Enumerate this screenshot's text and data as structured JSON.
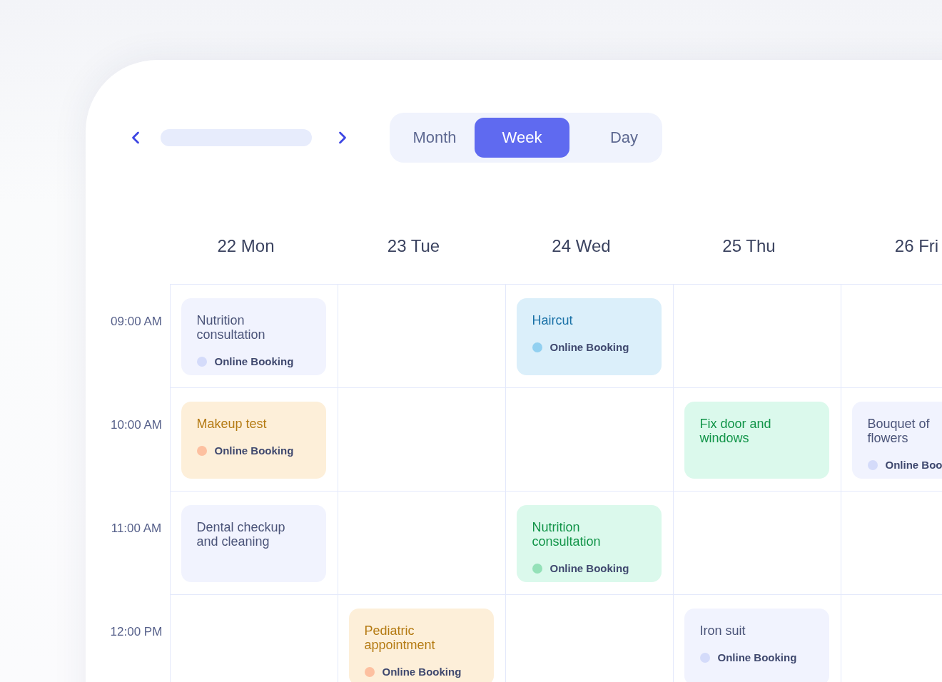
{
  "toolbar": {
    "views": [
      {
        "label": "Month",
        "selected": false
      },
      {
        "label": "Week",
        "selected": true
      },
      {
        "label": "Day",
        "selected": false
      }
    ]
  },
  "days": [
    "22 Mon",
    "23 Tue",
    "24 Wed",
    "25 Thu",
    "26 Fri"
  ],
  "rows": [
    {
      "time": "09:00 AM",
      "cells": [
        {
          "title": {
            "label": "Nutrition consultation",
            "color": "#4b5479"
          },
          "color": "#f1f3fe",
          "booking": {
            "label": "Online Booking",
            "color": "#d4dbfa"
          }
        },
        null,
        {
          "title": {
            "label": "Haircut",
            "color": "#1870a6"
          },
          "color": "#dbeffa",
          "booking": {
            "label": "Online Booking",
            "color": "#92d0f0"
          }
        },
        null,
        null
      ]
    },
    {
      "time": "10:00 AM",
      "cells": [
        {
          "title": {
            "label": "Makeup test",
            "color": "#b47a12"
          },
          "color": "#fdefd9",
          "booking": {
            "label": "Online Booking",
            "color": "#fdc0a0"
          }
        },
        null,
        null,
        {
          "title": {
            "label": "Fix door and windows",
            "color": "#119448"
          },
          "color": "#dbf9ec"
        },
        {
          "title": {
            "label": "Bouquet of flowers",
            "color": "#4b5479"
          },
          "color": "#f1f3fe",
          "booking": {
            "label": "Online Boo",
            "color": "#d4dbfa"
          }
        }
      ]
    },
    {
      "time": "11:00 AM",
      "cells": [
        {
          "title": {
            "label": "Dental checkup and cleaning",
            "color": "#4b5479"
          },
          "color": "#f1f3fe"
        },
        null,
        {
          "title": {
            "label": "Nutrition consultation",
            "color": "#119448"
          },
          "color": "#dbf9ec",
          "booking": {
            "label": "Online Booking",
            "color": "#94e1b8"
          }
        },
        null,
        null
      ]
    },
    {
      "time": "12:00 PM",
      "cells": [
        null,
        {
          "title": {
            "label": "Pediatric appointment",
            "color": "#b47a12"
          },
          "color": "#fdefd9",
          "booking": {
            "label": "Online Booking",
            "color": "#fdc0a0"
          }
        },
        null,
        {
          "title": {
            "label": "Iron suit",
            "color": "#4b5479"
          },
          "color": "#f1f3fe",
          "booking": {
            "label": "Online Booking",
            "color": "#d4dbfa"
          }
        },
        null
      ]
    }
  ]
}
